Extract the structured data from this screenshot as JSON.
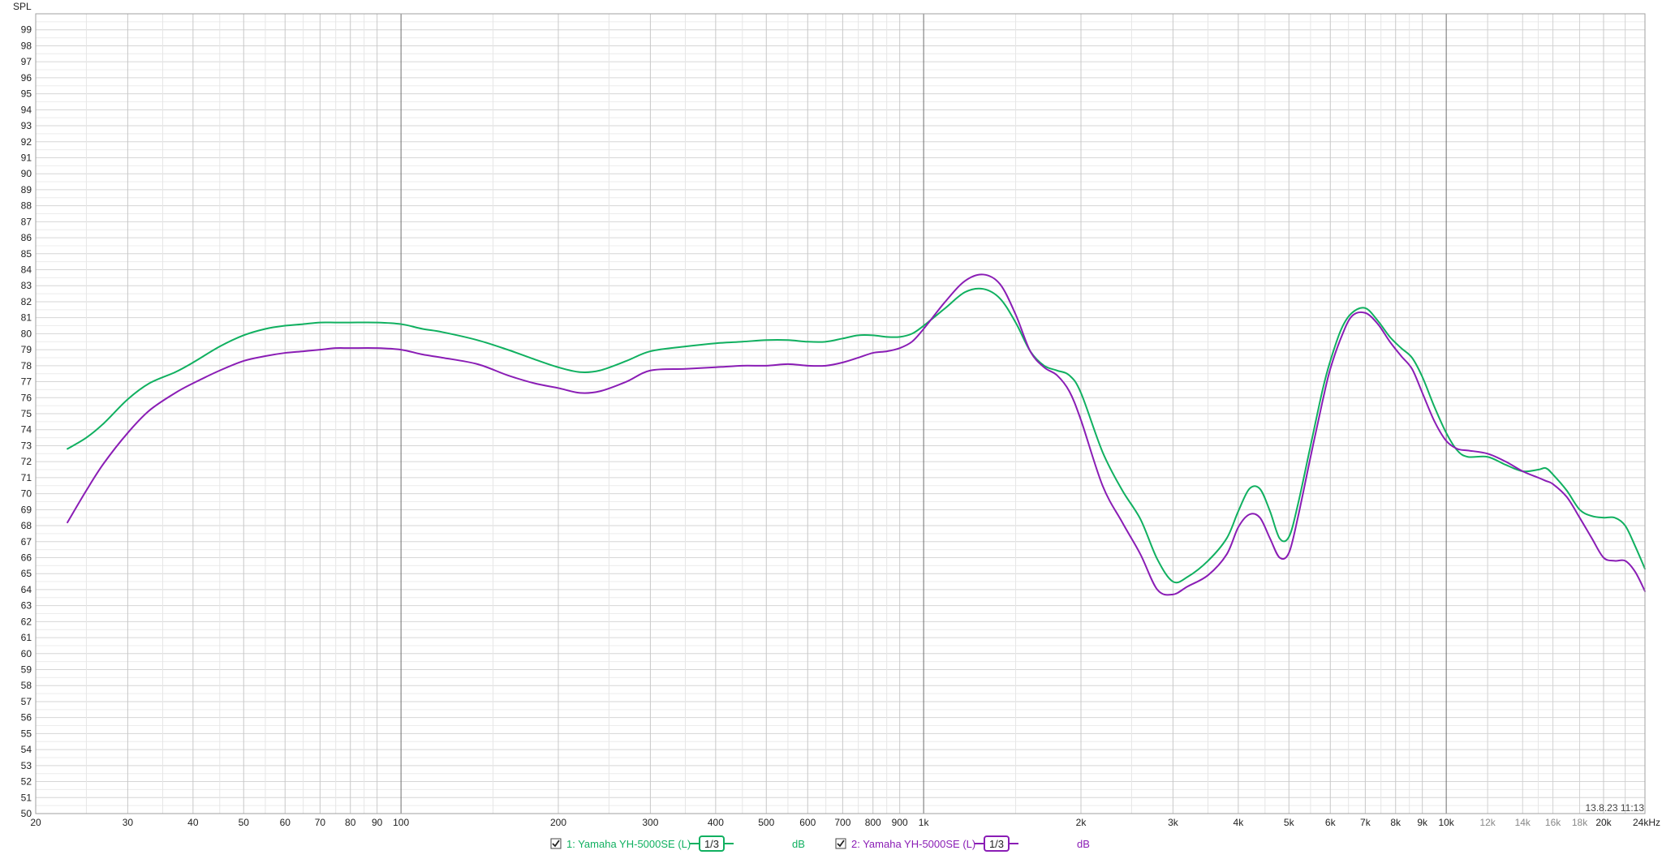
{
  "chart_data": {
    "type": "line",
    "ylabel": "SPL",
    "xscale": "log",
    "xlim": [
      20,
      24000
    ],
    "ylim": [
      50,
      100
    ],
    "grid": true,
    "x_tick_labels": [
      {
        "v": 20,
        "t": "20",
        "minor": false
      },
      {
        "v": 30,
        "t": "30",
        "minor": false
      },
      {
        "v": 40,
        "t": "40",
        "minor": false
      },
      {
        "v": 50,
        "t": "50",
        "minor": false
      },
      {
        "v": 60,
        "t": "60",
        "minor": false
      },
      {
        "v": 70,
        "t": "70",
        "minor": false
      },
      {
        "v": 80,
        "t": "80",
        "minor": false
      },
      {
        "v": 90,
        "t": "90",
        "minor": false
      },
      {
        "v": 100,
        "t": "100",
        "minor": false
      },
      {
        "v": 200,
        "t": "200",
        "minor": false
      },
      {
        "v": 300,
        "t": "300",
        "minor": false
      },
      {
        "v": 400,
        "t": "400",
        "minor": false
      },
      {
        "v": 500,
        "t": "500",
        "minor": false
      },
      {
        "v": 600,
        "t": "600",
        "minor": false
      },
      {
        "v": 700,
        "t": "700",
        "minor": false
      },
      {
        "v": 800,
        "t": "800",
        "minor": false
      },
      {
        "v": 900,
        "t": "900",
        "minor": false
      },
      {
        "v": 1000,
        "t": "1k",
        "minor": false
      },
      {
        "v": 2000,
        "t": "2k",
        "minor": false
      },
      {
        "v": 3000,
        "t": "3k",
        "minor": false
      },
      {
        "v": 4000,
        "t": "4k",
        "minor": false
      },
      {
        "v": 5000,
        "t": "5k",
        "minor": false
      },
      {
        "v": 6000,
        "t": "6k",
        "minor": false
      },
      {
        "v": 7000,
        "t": "7k",
        "minor": false
      },
      {
        "v": 8000,
        "t": "8k",
        "minor": false
      },
      {
        "v": 9000,
        "t": "9k",
        "minor": false
      },
      {
        "v": 10000,
        "t": "10k",
        "minor": false
      },
      {
        "v": 12000,
        "t": "12k",
        "minor": true
      },
      {
        "v": 14000,
        "t": "14k",
        "minor": true
      },
      {
        "v": 16000,
        "t": "16k",
        "minor": true
      },
      {
        "v": 18000,
        "t": "18k",
        "minor": true
      },
      {
        "v": 20000,
        "t": "20k",
        "minor": false
      },
      {
        "v": 24000,
        "t": "24kHz",
        "minor": false
      }
    ],
    "y_ticks": [
      50,
      51,
      52,
      53,
      54,
      55,
      56,
      57,
      58,
      59,
      60,
      61,
      62,
      63,
      64,
      65,
      66,
      67,
      68,
      69,
      70,
      71,
      72,
      73,
      74,
      75,
      76,
      77,
      78,
      79,
      80,
      81,
      82,
      83,
      84,
      85,
      86,
      87,
      88,
      89,
      90,
      91,
      92,
      93,
      94,
      95,
      96,
      97,
      98,
      99
    ],
    "timestamp": "13.8.23 11:13",
    "series": [
      {
        "name": "1: Yamaha YH-5000SE (L)",
        "smoothing": "1/3",
        "unit": "dB",
        "color": "#10b060",
        "x": [
          23,
          25,
          27,
          30,
          33,
          37,
          40,
          45,
          50,
          55,
          60,
          65,
          70,
          75,
          80,
          90,
          100,
          110,
          120,
          140,
          160,
          180,
          200,
          220,
          240,
          270,
          300,
          350,
          400,
          450,
          500,
          550,
          600,
          650,
          700,
          750,
          800,
          850,
          900,
          950,
          1000,
          1100,
          1200,
          1300,
          1400,
          1500,
          1600,
          1700,
          1800,
          1900,
          2000,
          2200,
          2400,
          2600,
          2800,
          3000,
          3200,
          3500,
          3800,
          4000,
          4200,
          4400,
          4600,
          4800,
          5000,
          5200,
          5500,
          5800,
          6000,
          6300,
          6600,
          7000,
          7400,
          7800,
          8200,
          8600,
          9000,
          9500,
          10000,
          10500,
          11000,
          12000,
          13000,
          14000,
          15000,
          15500,
          16000,
          17000,
          18000,
          19000,
          20000,
          21000,
          22000,
          23000,
          24000
        ],
        "y": [
          72.8,
          73.5,
          74.4,
          75.9,
          76.9,
          77.6,
          78.2,
          79.2,
          79.9,
          80.3,
          80.5,
          80.6,
          80.7,
          80.7,
          80.7,
          80.7,
          80.6,
          80.3,
          80.1,
          79.6,
          79.0,
          78.4,
          77.9,
          77.6,
          77.7,
          78.3,
          78.9,
          79.2,
          79.4,
          79.5,
          79.6,
          79.6,
          79.5,
          79.5,
          79.7,
          79.9,
          79.9,
          79.8,
          79.8,
          80.0,
          80.5,
          81.6,
          82.6,
          82.8,
          82.2,
          80.7,
          78.9,
          78.0,
          77.7,
          77.4,
          76.3,
          72.6,
          70.2,
          68.4,
          65.9,
          64.5,
          64.8,
          65.8,
          67.2,
          68.9,
          70.3,
          70.3,
          68.9,
          67.2,
          67.3,
          69.3,
          73.0,
          76.5,
          78.3,
          80.3,
          81.3,
          81.6,
          80.8,
          79.8,
          79.1,
          78.5,
          77.3,
          75.4,
          73.8,
          72.7,
          72.3,
          72.3,
          71.8,
          71.4,
          71.5,
          71.6,
          71.2,
          70.2,
          69.0,
          68.6,
          68.5,
          68.5,
          68.0,
          66.7,
          65.3
        ]
      },
      {
        "name": "2: Yamaha YH-5000SE (L)",
        "smoothing": "1/3",
        "unit": "dB",
        "color": "#8a1db5",
        "x": [
          23,
          25,
          27,
          30,
          33,
          37,
          40,
          45,
          50,
          55,
          60,
          65,
          70,
          75,
          80,
          90,
          100,
          110,
          120,
          140,
          160,
          180,
          200,
          220,
          240,
          270,
          300,
          350,
          400,
          450,
          500,
          550,
          600,
          650,
          700,
          750,
          800,
          850,
          900,
          950,
          1000,
          1100,
          1200,
          1300,
          1400,
          1500,
          1600,
          1700,
          1800,
          1900,
          2000,
          2200,
          2400,
          2600,
          2800,
          3000,
          3200,
          3500,
          3800,
          4000,
          4200,
          4400,
          4600,
          4800,
          5000,
          5200,
          5500,
          5800,
          6000,
          6300,
          6600,
          7000,
          7400,
          7800,
          8200,
          8600,
          9000,
          9500,
          10000,
          10500,
          11000,
          12000,
          13000,
          14000,
          15000,
          15500,
          16000,
          17000,
          18000,
          19000,
          20000,
          21000,
          22000,
          23000,
          24000
        ],
        "y": [
          68.2,
          70.2,
          71.9,
          73.8,
          75.2,
          76.3,
          76.9,
          77.7,
          78.3,
          78.6,
          78.8,
          78.9,
          79.0,
          79.1,
          79.1,
          79.1,
          79.0,
          78.7,
          78.5,
          78.1,
          77.4,
          76.9,
          76.6,
          76.3,
          76.4,
          77.0,
          77.7,
          77.8,
          77.9,
          78.0,
          78.0,
          78.1,
          78.0,
          78.0,
          78.2,
          78.5,
          78.8,
          78.9,
          79.1,
          79.5,
          80.3,
          82.0,
          83.3,
          83.7,
          83.1,
          81.2,
          78.9,
          77.9,
          77.4,
          76.4,
          74.6,
          70.5,
          68.2,
          66.2,
          64.0,
          63.7,
          64.2,
          64.9,
          66.2,
          67.9,
          68.7,
          68.5,
          67.2,
          66.0,
          66.3,
          68.5,
          72.3,
          75.8,
          77.8,
          79.8,
          81.1,
          81.3,
          80.6,
          79.5,
          78.6,
          77.8,
          76.3,
          74.5,
          73.3,
          72.8,
          72.7,
          72.5,
          72.0,
          71.4,
          71.0,
          70.8,
          70.6,
          69.8,
          68.5,
          67.2,
          66.0,
          65.8,
          65.8,
          65.1,
          63.9
        ]
      }
    ]
  }
}
